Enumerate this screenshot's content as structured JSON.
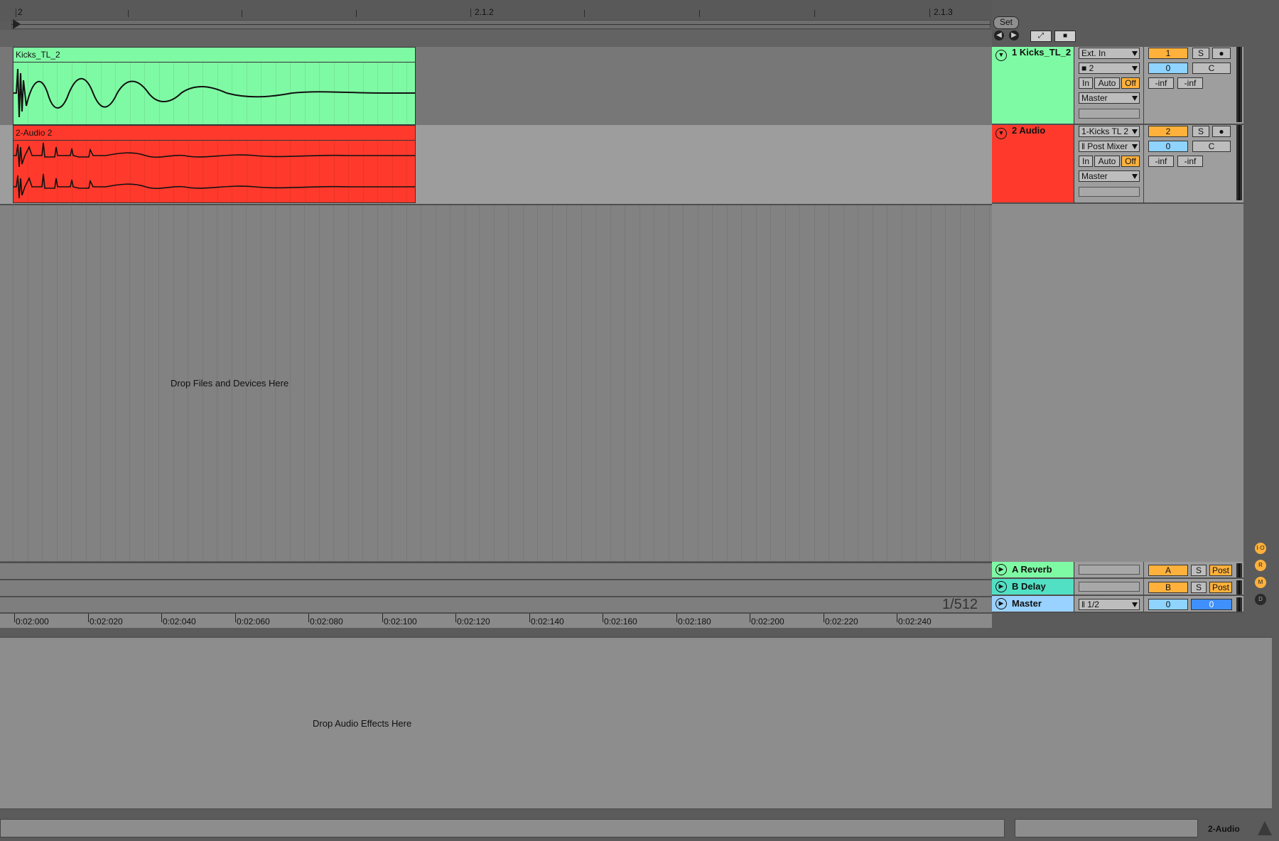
{
  "ruler": {
    "bar_labels": [
      "2",
      "2.1.2",
      "2.1.3"
    ]
  },
  "set": {
    "label": "Set"
  },
  "tracks": [
    {
      "clip_name": "Kicks_TL_2",
      "header_title": "1 Kicks_TL_2",
      "color": "#7ffaa4",
      "input_type": "Ext. In",
      "input_channel": "2",
      "monitor": [
        "In",
        "Auto",
        "Off"
      ],
      "output": "Master",
      "number": "1",
      "solo": "S",
      "volume": "0",
      "pan": "C",
      "peak_left": "-inf",
      "peak_right": "-inf"
    },
    {
      "clip_name": "2-Audio 2",
      "header_title": "2 Audio",
      "color": "#ff3a2d",
      "input_type": "1-Kicks TL 2",
      "input_channel": "Post Mixer",
      "monitor": [
        "In",
        "Auto",
        "Off"
      ],
      "output": "Master",
      "number": "2",
      "solo": "S",
      "volume": "0",
      "pan": "C",
      "peak_left": "-inf",
      "peak_right": "-inf"
    }
  ],
  "drop_files_text": "Drop Files and Devices Here",
  "returns": [
    {
      "name": "A Reverb",
      "letter": "A",
      "solo": "S",
      "post": "Post",
      "color": "#7ffaa4"
    },
    {
      "name": "B Delay",
      "letter": "B",
      "solo": "S",
      "post": "Post",
      "color": "#52e0c4"
    }
  ],
  "master": {
    "name": "Master",
    "output": "1/2",
    "volume": "0",
    "pan": "0",
    "color": "#9ad2ff"
  },
  "zoom_level": "1/512",
  "time_labels": [
    "0:02:000",
    "0:02:020",
    "0:02:040",
    "0:02:060",
    "0:02:080",
    "0:02:100",
    "0:02:120",
    "0:02:140",
    "0:02:160",
    "0:02:180",
    "0:02:200",
    "0:02:220",
    "0:02:240"
  ],
  "side_buttons": [
    "I·O",
    "R",
    "M",
    "D"
  ],
  "drop_fx_text": "Drop Audio Effects Here",
  "status_track": "2-Audio"
}
